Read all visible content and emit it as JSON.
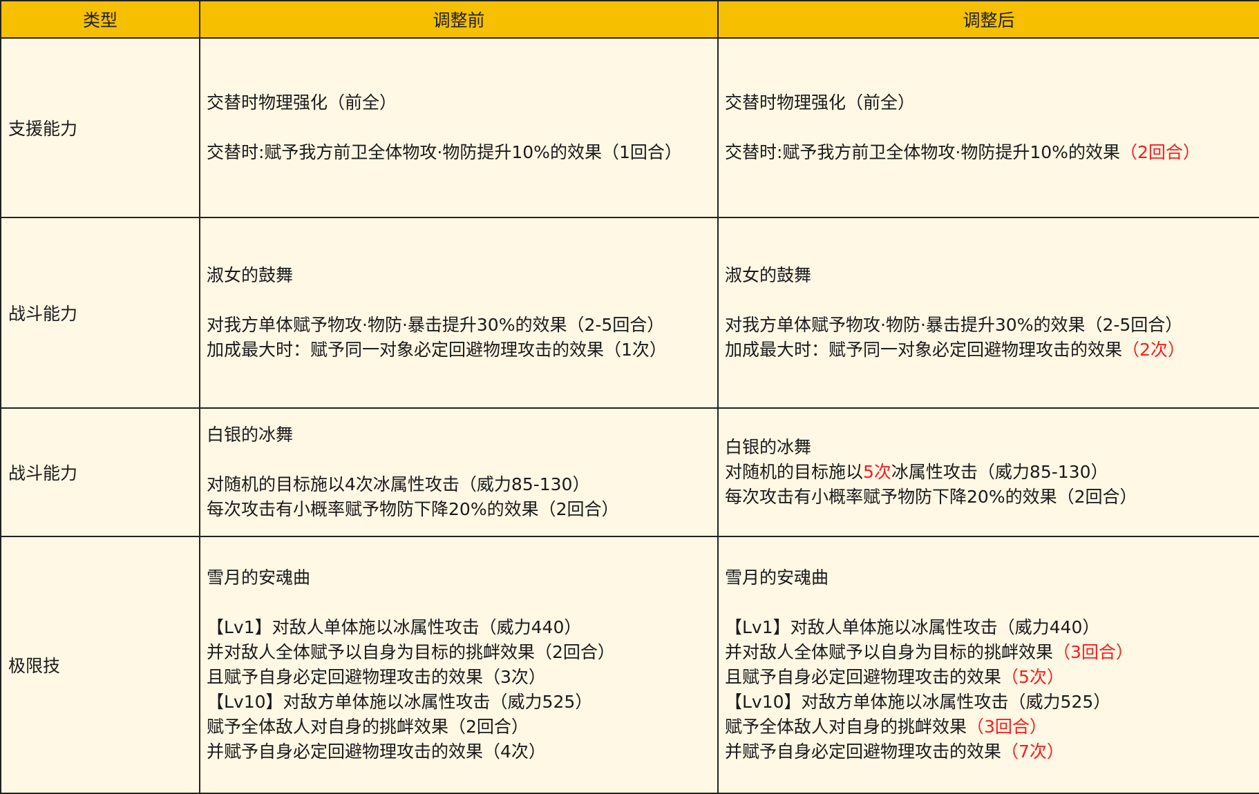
{
  "header": {
    "type": "类型",
    "before": "调整前",
    "after": "调整后"
  },
  "rows": [
    {
      "type": "支援能力",
      "before": {
        "title": "交替时物理强化（前全）",
        "l1": "交替时:赋予我方前卫全体物攻·物防提升10%的效果（1回合）"
      },
      "after": {
        "title": "交替时物理强化（前全）",
        "l1_a": "交替时:赋予我方前卫全体物攻·物防提升10%的效果",
        "l1_b": "（2回合）"
      }
    },
    {
      "type": "战斗能力",
      "before": {
        "title": "淑女的鼓舞",
        "l1": "对我方单体赋予物攻·物防·暴击提升30%的效果（2-5回合）",
        "l2": "加成最大时：赋予同一对象必定回避物理攻击的效果（1次）"
      },
      "after": {
        "title": "淑女的鼓舞",
        "l1": "对我方单体赋予物攻·物防·暴击提升30%的效果（2-5回合）",
        "l2_a": "加成最大时：赋予同一对象必定回避物理攻击的效果",
        "l2_b": "（2次）"
      }
    },
    {
      "type": "战斗能力",
      "before": {
        "title": "白银的冰舞",
        "l1": "对随机的目标施以4次冰属性攻击（威力85-130）",
        "l2": "每次攻击有小概率赋予物防下降20%的效果（2回合）"
      },
      "after": {
        "title": "白银的冰舞",
        "l1_a": "对随机的目标施以",
        "l1_b": "5次",
        "l1_c": "冰属性攻击（威力85-130）",
        "l2": "每次攻击有小概率赋予物防下降20%的效果（2回合）"
      }
    },
    {
      "type": "极限技",
      "before": {
        "title": "雪月的安魂曲",
        "l1": "【Lv1】对敌人单体施以冰属性攻击（威力440）",
        "l2": "并对敌人全体赋予以自身为目标的挑衅效果（2回合）",
        "l3": "且赋予自身必定回避物理攻击的效果（3次）",
        "l4": "【Lv10】对敌方单体施以冰属性攻击（威力525）",
        "l5": "赋予全体敌人对自身的挑衅效果（2回合）",
        "l6": "并赋予自身必定回避物理攻击的效果（4次）"
      },
      "after": {
        "title": "雪月的安魂曲",
        "l1": "【Lv1】对敌人单体施以冰属性攻击（威力440）",
        "l2_a": "并对敌人全体赋予以自身为目标的挑衅效果",
        "l2_b": "（3回合）",
        "l3_a": "且赋予自身必定回避物理攻击的效果",
        "l3_b": "（5次）",
        "l4": "【Lv10】对敌方单体施以冰属性攻击（威力525）",
        "l5_a": "赋予全体敌人对自身的挑衅效果",
        "l5_b": "（3回合）",
        "l6_a": "并赋予自身必定回避物理攻击的效果",
        "l6_b": "（7次）"
      }
    }
  ]
}
